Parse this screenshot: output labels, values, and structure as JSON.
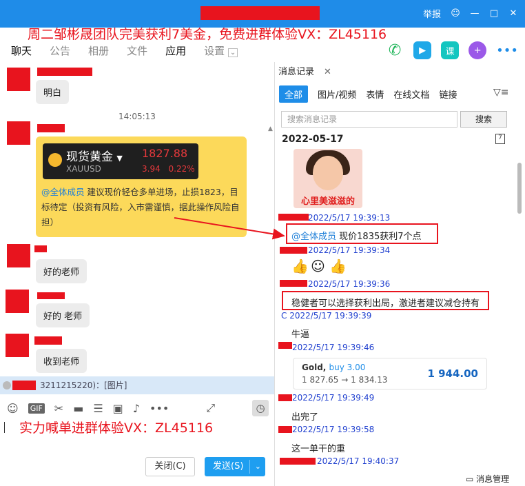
{
  "titlebar": {
    "report": "举报",
    "min": "—",
    "max": "□",
    "close": "✕"
  },
  "promo_top": "周二邹彬晟团队完美获利7美金，免费进群体验VX：ZL45116",
  "tabs": [
    "聊天",
    "公告",
    "相册",
    "文件",
    "应用",
    "设置"
  ],
  "chat": {
    "msg1": "明白",
    "timestamp": "14:05:13",
    "gold": {
      "name": "现货黄金",
      "symbol": "XAUUSD",
      "price": "1827.88",
      "change": "3.94",
      "pct": "0.22%",
      "mention": "@全体成员",
      "text": "建议现价轻仓多单进场，止损1823，目标待定（投资有风险，入市需谨慎，据此操作风险自担）"
    },
    "msg2": "好的老师",
    "msg3": "好的  老师",
    "msg4": "收到老师",
    "notice": "3211215220)：[图片]"
  },
  "promo_bottom": "实力喊单进群体验VX：ZL45116",
  "buttons": {
    "close": "关闭(C)",
    "send": "发送(S)"
  },
  "history": {
    "tab": "消息记录",
    "filters": [
      "全部",
      "图片/视频",
      "表情",
      "在线文档",
      "链接"
    ],
    "search_placeholder": "搜索消息记录",
    "search_btn": "搜索",
    "date": "2022-05-17",
    "sticker_caption": "心里美滋滋的",
    "t1": "2022/5/17 19:39:13",
    "m1_mention": "@全体成员",
    "m1": "现价1835获利7个点",
    "t2": "2022/5/17 19:39:34",
    "t3": "2022/5/17 19:39:36",
    "m3": "稳健者可以选择获利出局，激进者建议减仓持有",
    "t4": "C 2022/5/17 19:39:39",
    "m4": "牛逼",
    "t5": "2022/5/17 19:39:46",
    "trade": {
      "symbol": "Gold,",
      "side": "buy 3.00",
      "range": "1 827.65 → 1 834.13",
      "value": "1 944.00"
    },
    "t6": "2022/5/17 19:39:49",
    "m6": "出完了",
    "t7": "2022/5/17 19:39:58",
    "m7": "这一单干的重",
    "t8": "2022/5/17 19:40:37",
    "manage": "消息管理"
  },
  "colors": {
    "brand": "#1f8ce8",
    "redact": "#e8141e",
    "gold_card": "#fcd95a"
  }
}
